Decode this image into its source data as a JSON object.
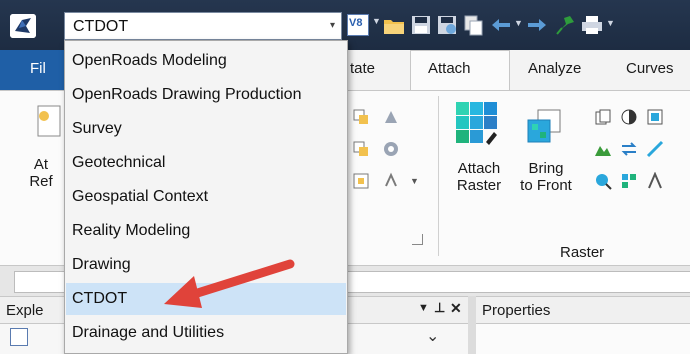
{
  "title_bar": {
    "workspace_combo": {
      "value": "CTDOT",
      "arrow": "▾"
    },
    "combo_badge": "V8",
    "qat_icons": [
      "open-folder-icon",
      "save-icon",
      "save-settings-icon",
      "copy-icon",
      "undo-icon",
      "redo-icon",
      "pin-icon",
      "print-icon"
    ]
  },
  "ribbon": {
    "tabs": [
      {
        "label": "Fil",
        "active": false
      },
      {
        "label": "tate",
        "active": false
      },
      {
        "label": "Attach",
        "active": true
      },
      {
        "label": "Analyze",
        "active": false
      },
      {
        "label": "Curves",
        "active": false
      }
    ],
    "left_partial": {
      "line1": "At",
      "line2": "Ref"
    },
    "buttons": [
      {
        "name": "attach-raster",
        "line1": "Attach",
        "line2": "Raster"
      },
      {
        "name": "bring-to-front",
        "line1": "Bring",
        "line2": "to Front"
      }
    ],
    "group_label": "Raster"
  },
  "panels": {
    "explorer_title": "Exple",
    "explorer_controls": [
      "▼",
      "🖈",
      "✕"
    ],
    "properties_title": "Properties",
    "dropdown_glyph": "⌄"
  },
  "dropdown": {
    "items": [
      {
        "label": "OpenRoads Modeling",
        "selected": false
      },
      {
        "label": "OpenRoads Drawing Production",
        "selected": false
      },
      {
        "label": "Survey",
        "selected": false
      },
      {
        "label": "Geotechnical",
        "selected": false
      },
      {
        "label": "Geospatial Context",
        "selected": false
      },
      {
        "label": "Reality Modeling",
        "selected": false
      },
      {
        "label": "Drawing",
        "selected": false
      },
      {
        "label": "CTDOT",
        "selected": true
      },
      {
        "label": "Drainage and Utilities",
        "selected": false
      }
    ]
  },
  "colors": {
    "title_bar": "#1f2e45",
    "selection": "#cde3f7",
    "annotation_arrow": "#e0433a"
  }
}
